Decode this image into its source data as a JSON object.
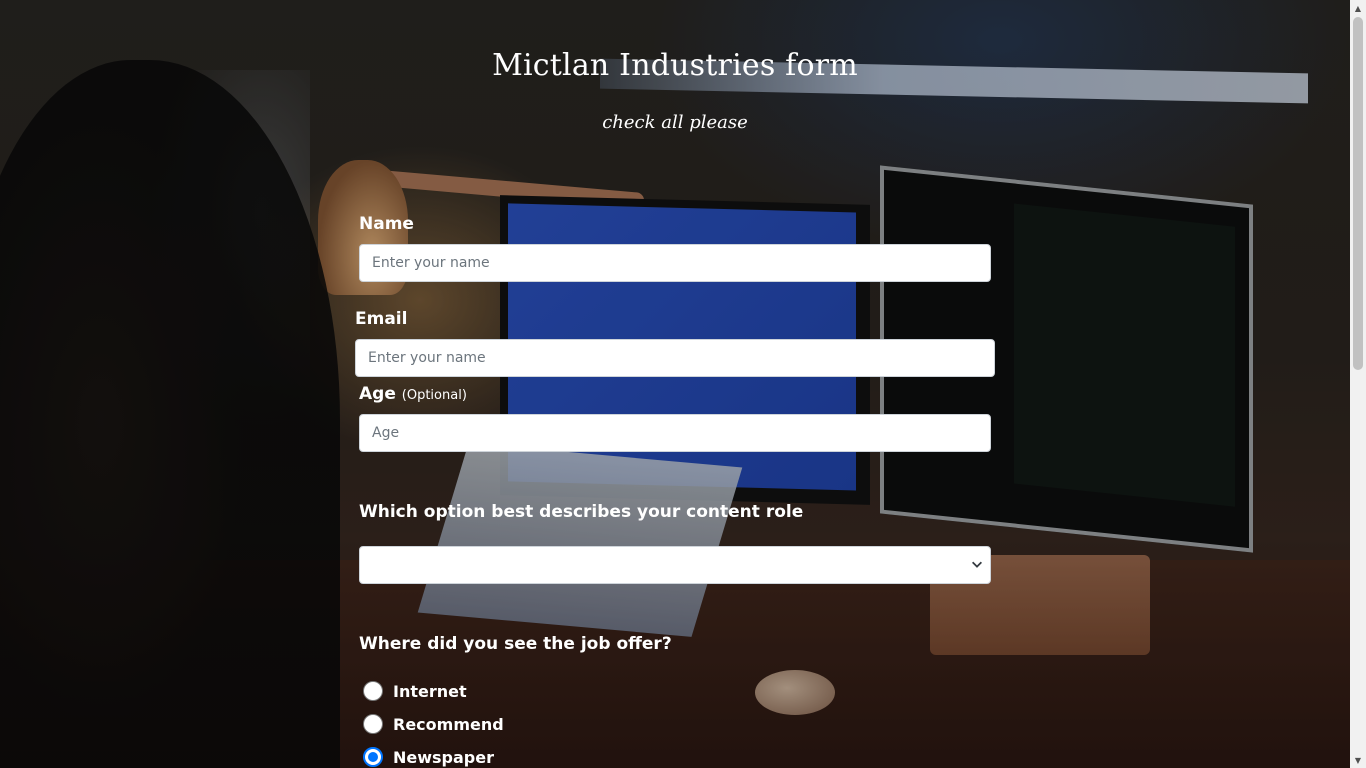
{
  "form": {
    "title": "Mictlan Industries form",
    "subtitle": "check all please",
    "name": {
      "label": "Name",
      "placeholder": "Enter your name",
      "value": ""
    },
    "email": {
      "label": "Email",
      "placeholder": "Enter your name",
      "value": ""
    },
    "age": {
      "label": "Age",
      "optional_note": "(Optional)",
      "placeholder": "Age",
      "value": ""
    },
    "role": {
      "label": "Which option best describes your content role",
      "selected": ""
    },
    "source": {
      "label": "Where did you see the job offer?",
      "options": [
        "Internet",
        "Recommend",
        "Newspaper"
      ],
      "selected": "Newspaper"
    }
  },
  "colors": {
    "radio_accent": "#0075ff",
    "text": "#ffffff",
    "field_bg": "#ffffff"
  },
  "icons": {
    "select_arrow": "chevron-down-icon",
    "scroll_up": "scroll-up-arrow-icon",
    "scroll_down": "scroll-down-arrow-icon"
  }
}
